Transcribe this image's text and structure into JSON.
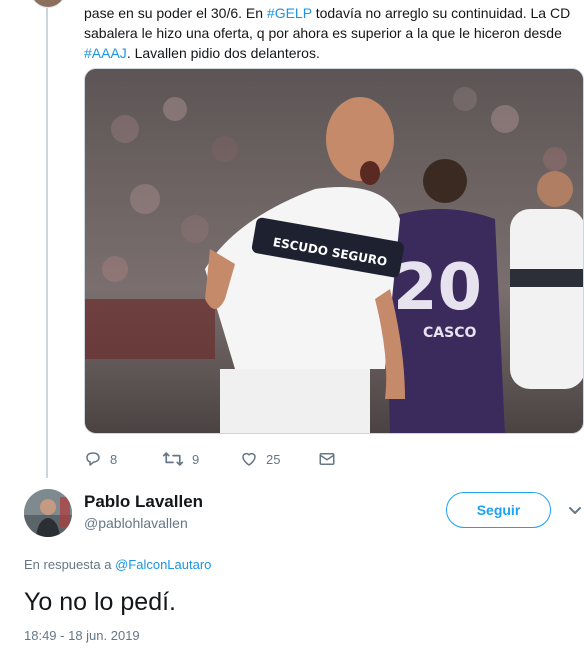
{
  "prev_tweet": {
    "text_parts": [
      {
        "t": "pase en su poder el 30/6. En ",
        "tag": false
      },
      {
        "t": "#GELP",
        "tag": true
      },
      {
        "t": " todavía no arreglo su continuidad. La CD sabalera le hizo una oferta, q por ahora es superior a la que le hiceron desde ",
        "tag": false
      },
      {
        "t": "#AAAJ",
        "tag": true
      },
      {
        "t": ". Lavallen pidio dos delanteros.",
        "tag": false
      }
    ],
    "photo": {
      "jersey_sponsor": "ESCUDO SEGURO",
      "opponent_number": "20",
      "opponent_name": "CASCO"
    },
    "actions": {
      "replies": "8",
      "retweets": "9",
      "likes": "25"
    }
  },
  "reply_tweet": {
    "author_name": "Pablo Lavallen",
    "author_handle": "@pablohlavallen",
    "follow_label": "Seguir",
    "in_reply_prefix": "En respuesta a",
    "in_reply_user": "@FalconLautaro",
    "text": "Yo no lo pedí.",
    "timestamp": "18:49 - 18 jun. 2019"
  },
  "colors": {
    "link": "#1b95e0",
    "accent": "#1da1f2",
    "muted": "#657786",
    "text": "#14171a"
  },
  "icons": [
    "reply-icon",
    "retweet-icon",
    "like-icon",
    "message-icon",
    "chevron-down-icon"
  ]
}
